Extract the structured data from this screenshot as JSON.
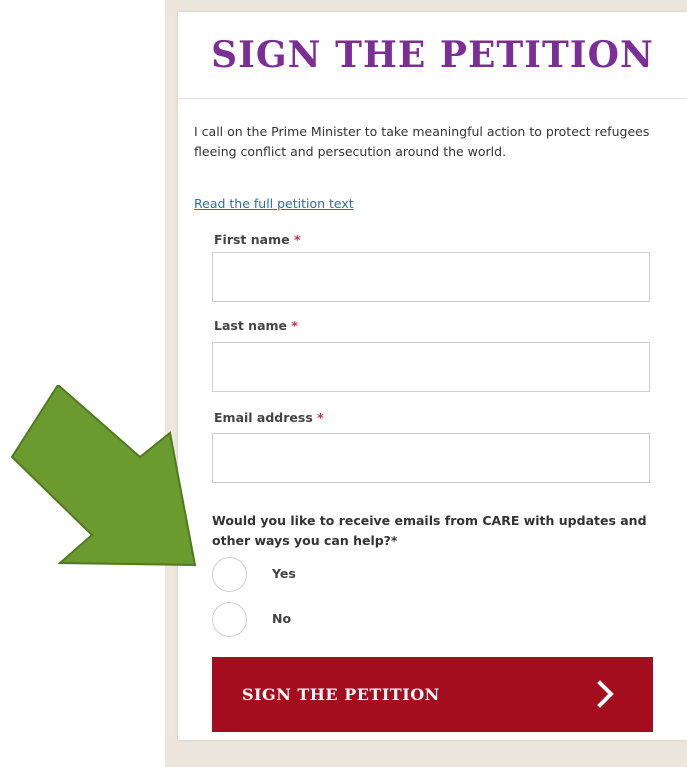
{
  "petition": {
    "title": "SIGN THE PETITION",
    "intro": "I call on the Prime Minister to take meaningful action to protect refugees fleeing conflict and persecution around the world.",
    "read_link": "Read the full petition text"
  },
  "form": {
    "first_name_label": "First name",
    "last_name_label": "Last name",
    "email_label": "Email address",
    "required_marker": "*",
    "first_name_value": "",
    "last_name_value": "",
    "email_value": "",
    "question": "Would you like to receive emails from CARE with updates and other ways you can help?*",
    "options": [
      "Yes",
      "No"
    ],
    "submit_label": "SIGN THE PETITION",
    "submit_icon": "chevron-right-icon"
  },
  "annotation": {
    "icon": "arrow-down-right-icon",
    "color": "#6b9a2e"
  },
  "colors": {
    "title": "#7b2f96",
    "button": "#a30d1e",
    "link": "#2f6fa0",
    "required": "#c0304a"
  }
}
